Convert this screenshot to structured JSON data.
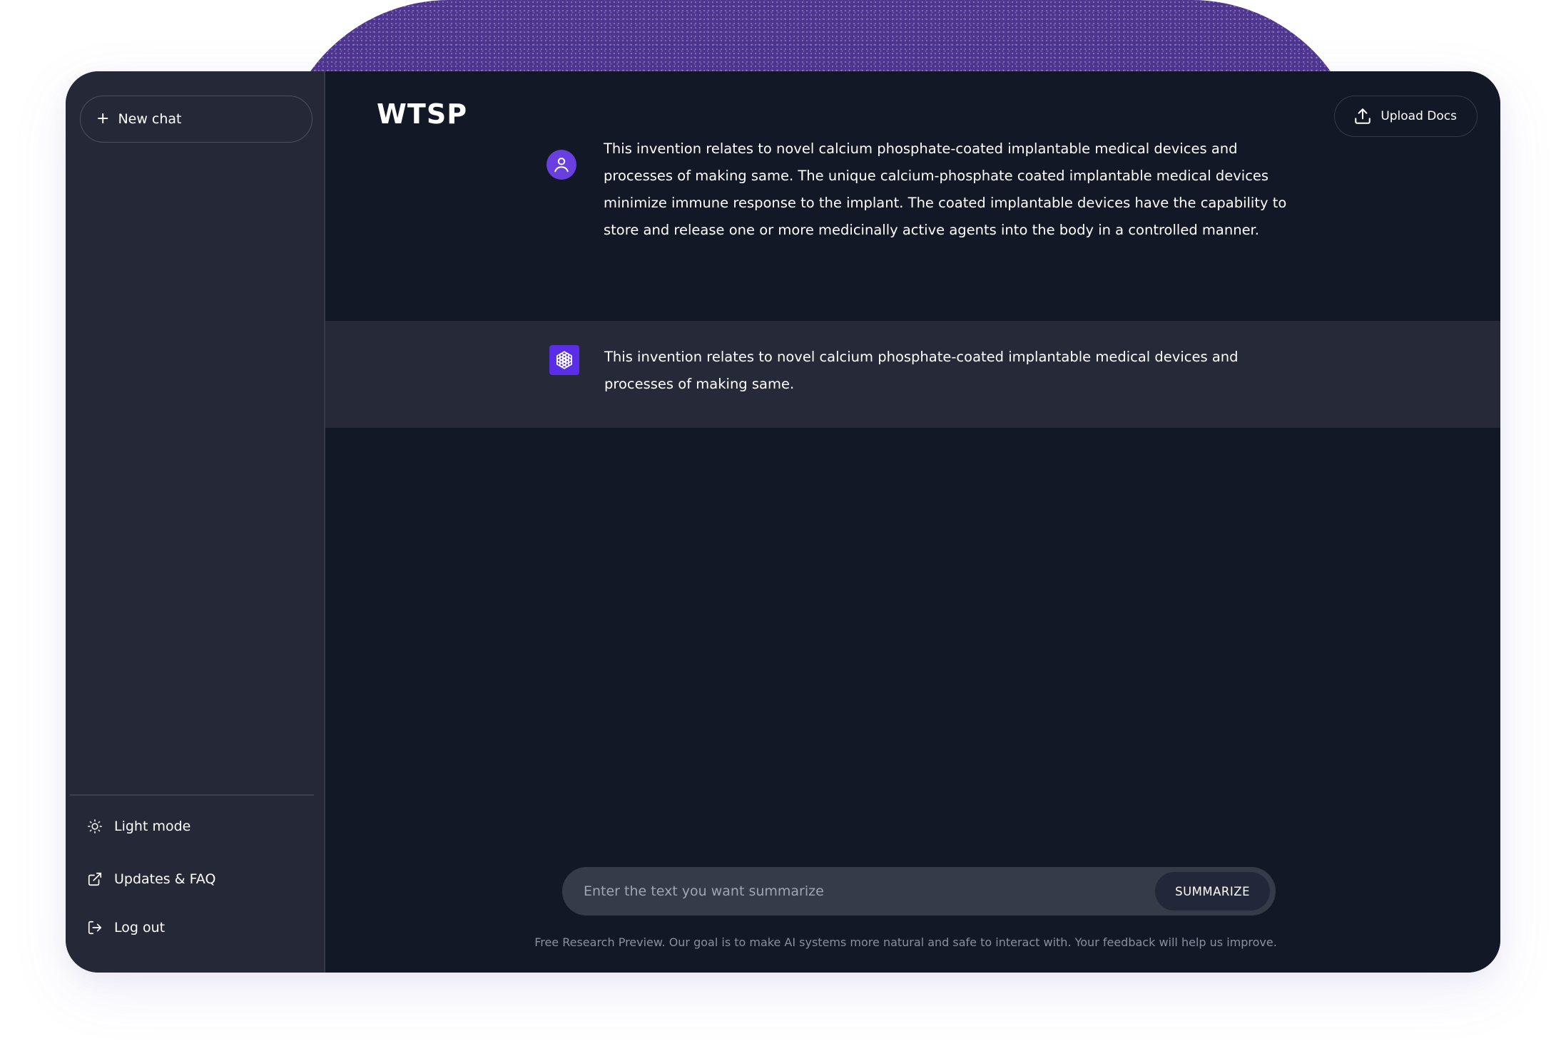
{
  "app": {
    "title": "WTSP"
  },
  "sidebar": {
    "new_chat_label": "New chat",
    "items": [
      {
        "label": "Light mode",
        "icon": "sun-icon"
      },
      {
        "label": "Updates & FAQ",
        "icon": "external-link-icon"
      },
      {
        "label": "Log out",
        "icon": "logout-icon"
      }
    ]
  },
  "header": {
    "upload_label": "Upload Docs",
    "upload_icon": "upload-icon"
  },
  "conversation": [
    {
      "role": "user",
      "icon": "user-icon",
      "text": "This invention relates to novel calcium phosphate-coated implantable medical devices and processes of making same. The unique calcium-phosphate coated implantable medical devices minimize immune response to the implant. The coated implantable devices have the capability to store and release one or more medicinally active agents into the body in a controlled manner."
    },
    {
      "role": "assistant",
      "icon": "openai-logo-icon",
      "text": "This invention relates to novel calcium phosphate-coated implantable medical devices and processes of making same."
    }
  ],
  "composer": {
    "placeholder": "Enter the text you want summarize",
    "value": "",
    "submit_label": "SUMMARIZE"
  },
  "footer": {
    "note": "Free Research Preview. Our goal is to make AI systems more natural and safe to interact with. Your feedback will help us improve."
  },
  "colors": {
    "accent": "#5a2ee6",
    "sidebar_bg": "#252937",
    "main_bg": "#131826",
    "bot_row_bg": "#252938",
    "backdrop_arc": "#4e3590"
  }
}
